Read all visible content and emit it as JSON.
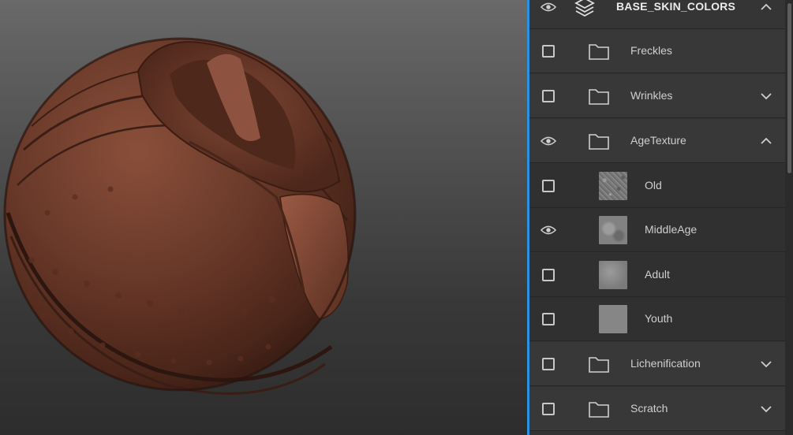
{
  "viewport": {
    "background_top": "#696969",
    "background_bottom": "#2d2d2d",
    "object_color": "#6b3a2a"
  },
  "panel": {
    "accent_color": "#2f8fe0",
    "root": {
      "label": "BASE_SKIN_COLORS",
      "visible": true,
      "expanded": true,
      "icon": "layers-icon"
    },
    "items": [
      {
        "label": "Freckles",
        "kind": "folder",
        "visible": false,
        "chevron": "none"
      },
      {
        "label": "Wrinkles",
        "kind": "folder",
        "visible": false,
        "chevron": "down"
      },
      {
        "label": "AgeTexture",
        "kind": "folder",
        "visible": true,
        "chevron": "up"
      },
      {
        "label": "Old",
        "kind": "layer",
        "visible": false,
        "thumbnail": "noise-fine"
      },
      {
        "label": "MiddleAge",
        "kind": "layer",
        "visible": true,
        "thumbnail": "noise-soft"
      },
      {
        "label": "Adult",
        "kind": "layer",
        "visible": false,
        "thumbnail": "smooth-gradient"
      },
      {
        "label": "Youth",
        "kind": "layer",
        "visible": false,
        "thumbnail": "flat-gray"
      },
      {
        "label": "Lichenification",
        "kind": "folder",
        "visible": false,
        "chevron": "down"
      },
      {
        "label": "Scratch",
        "kind": "folder",
        "visible": false,
        "chevron": "down"
      }
    ]
  }
}
